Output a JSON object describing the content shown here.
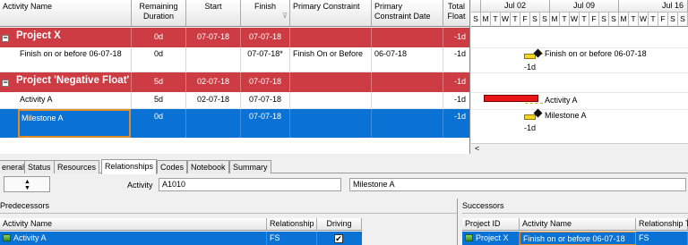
{
  "grid": {
    "columns": [
      "Activity Name",
      "Remaining Duration",
      "Start",
      "Finish",
      "Primary Constraint",
      "Primary Constraint Date",
      "Total Float"
    ],
    "rows": [
      {
        "name": "Project X",
        "rem": "0d",
        "start": "07-07-18",
        "finish": "07-07-18",
        "pc": "",
        "pcd": "",
        "tf": "-1d",
        "toggle": "−"
      },
      {
        "name": "Finish on or before 06-07-18",
        "rem": "0d",
        "start": "",
        "finish": "07-07-18*",
        "pc": "Finish On or Before",
        "pcd": "06-07-18",
        "tf": "-1d"
      },
      {
        "name": "Project 'Negative Float'",
        "rem": "5d",
        "start": "02-07-18",
        "finish": "07-07-18",
        "pc": "",
        "pcd": "",
        "tf": "-1d",
        "toggle": "−"
      },
      {
        "name": "Activity A",
        "rem": "5d",
        "start": "02-07-18",
        "finish": "07-07-18",
        "pc": "",
        "pcd": "",
        "tf": "-1d"
      },
      {
        "name": "Milestone A",
        "rem": "0d",
        "start": "",
        "finish": "07-07-18",
        "pc": "",
        "pcd": "",
        "tf": "-1d"
      }
    ]
  },
  "gantt": {
    "weeks": [
      "Jul 02",
      "Jul 09",
      "Jul 16"
    ],
    "days": [
      "S",
      "M",
      "T",
      "W",
      "T",
      "F",
      "S",
      "S",
      "M",
      "T",
      "W",
      "T",
      "F",
      "S",
      "S",
      "M",
      "T",
      "W",
      "T",
      "F",
      "S",
      "S"
    ],
    "labels": {
      "finish_on_or_before": "Finish on or before 06-07-18",
      "activity_a": "Activity A",
      "milestone_a": "Milestone A",
      "float_1": "-1d",
      "float_2": "-1d"
    },
    "scroll_left": "<"
  },
  "tabs": [
    "eneral",
    "Status",
    "Resources",
    "Relationships",
    "Codes",
    "Notebook",
    "Summary"
  ],
  "details": {
    "spin_up": "▲",
    "spin_down": "▼",
    "activity_label": "Activity",
    "activity_id": "A1010",
    "activity_name": "Milestone A"
  },
  "predecessors": {
    "title": "Predecessors",
    "columns": [
      "Activity Name",
      "Relationship",
      "Driving"
    ],
    "row": {
      "name": "Activity A",
      "relationship": "FS",
      "driving": "✔"
    }
  },
  "successors": {
    "title": "Successors",
    "columns": [
      "Project ID",
      "Activity Name",
      "Relationship T"
    ],
    "row": {
      "project": "Project X",
      "name": "Finish on or before 06-07-18",
      "relationship": "FS"
    }
  },
  "colors": {
    "project_band": "#cd3b43",
    "selection": "#0a72d4",
    "bar": "#e81416",
    "edit_border": "#e08a2c"
  }
}
